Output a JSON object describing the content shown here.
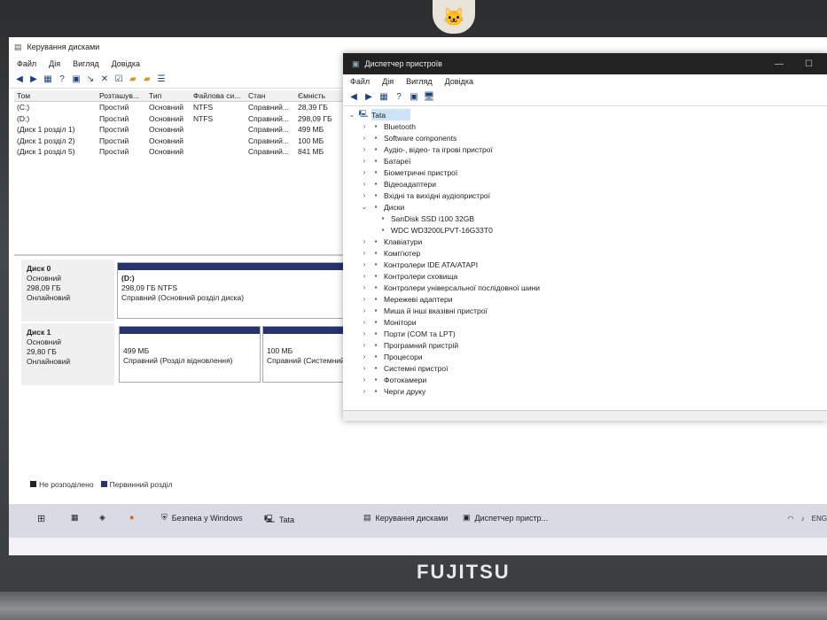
{
  "disk_mgmt": {
    "title": "Керування дисками",
    "menu": [
      "Файл",
      "Дія",
      "Вигляд",
      "Довідка"
    ],
    "columns": [
      "Том",
      "Розташув...",
      "Тип",
      "Файлова си...",
      "Стан",
      "Ємність"
    ],
    "volumes": [
      [
        "(C:)",
        "Простий",
        "Основний",
        "NTFS",
        "Справний...",
        "28,39 ГБ"
      ],
      [
        "(D:)",
        "Простий",
        "Основний",
        "NTFS",
        "Справний...",
        "298,09 ГБ"
      ],
      [
        "(Диск 1 розділ 1)",
        "Простий",
        "Основний",
        "",
        "Справний...",
        "499 МБ"
      ],
      [
        "(Диск 1 розділ 2)",
        "Простий",
        "Основний",
        "",
        "Справний...",
        "100 МБ"
      ],
      [
        "(Диск 1 розділ 5)",
        "Простий",
        "Основний",
        "",
        "Справний...",
        "841 МБ"
      ]
    ],
    "disk0": {
      "name": "Диск 0",
      "type": "Основний",
      "size": "298,09 ГБ",
      "status": "Онлайновий",
      "part_name": "(D:)",
      "part_size": "298,09 ГБ NTFS",
      "part_status": "Справний (Основний розділ диска)"
    },
    "disk1": {
      "name": "Диск 1",
      "type": "Основний",
      "size": "29,80 ГБ",
      "status": "Онлайновий",
      "p1_size": "499 МБ",
      "p1_status": "Справний (Розділ відновлення)",
      "p2_size": "100 МБ",
      "p2_status": "Справний (Системний ро"
    },
    "legend": [
      "Не розподілено",
      "Первинний розділ"
    ]
  },
  "device_mgr": {
    "title": "Диспетчер пристроїв",
    "menu": [
      "Файл",
      "Дія",
      "Вигляд",
      "Довідка"
    ],
    "root": "Tata",
    "nodes": [
      {
        "label": "Bluetooth",
        "icon": "bluetooth-icon"
      },
      {
        "label": "Software components",
        "icon": "software-icon"
      },
      {
        "label": "Аудіо-, відео- та ігрові пристрої",
        "icon": "audio-icon"
      },
      {
        "label": "Батареї",
        "icon": "battery-icon"
      },
      {
        "label": "Біометричні пристрої",
        "icon": "biometric-icon"
      },
      {
        "label": "Відеоадаптери",
        "icon": "display-adapter-icon"
      },
      {
        "label": "Вхідні та вихідні аудіопристрої",
        "icon": "audio-io-icon"
      },
      {
        "label": "Диски",
        "icon": "disk-drive-icon"
      }
    ],
    "disk_children": [
      "SanDisk SSD i100 32GB",
      "WDC WD3200LPVT-16G33T0"
    ],
    "nodes_after": [
      {
        "label": "Клавіатури",
        "icon": "keyboard-icon"
      },
      {
        "label": "Комп'ютер",
        "icon": "computer-icon"
      },
      {
        "label": "Контролери IDE ATA/ATAPI",
        "icon": "ide-icon"
      },
      {
        "label": "Контролери сховища",
        "icon": "storage-icon"
      },
      {
        "label": "Контролери універсальної послідовної шини",
        "icon": "usb-icon"
      },
      {
        "label": "Мережеві адаптери",
        "icon": "network-icon"
      },
      {
        "label": "Миша й інші вказівні пристрої",
        "icon": "mouse-icon"
      },
      {
        "label": "Монітори",
        "icon": "monitor-icon"
      },
      {
        "label": "Порти (COM та LPT)",
        "icon": "port-icon"
      },
      {
        "label": "Програмний пристрій",
        "icon": "software-device-icon"
      },
      {
        "label": "Процесори",
        "icon": "processor-icon"
      },
      {
        "label": "Системні пристрої",
        "icon": "system-icon"
      },
      {
        "label": "Фотокамери",
        "icon": "camera-icon"
      },
      {
        "label": "Черги друку",
        "icon": "printer-icon"
      }
    ]
  },
  "taskbar": {
    "security": "Безпека у Windows",
    "tata": "Tata",
    "disk_mgmt": "Керування дисками",
    "device_mgr": "Диспетчер пристр...",
    "lang": "ENG"
  },
  "laptop_brand": "FUJITSU",
  "colors": {
    "partition_bar": "#26336e",
    "unallocated": "#222222"
  }
}
